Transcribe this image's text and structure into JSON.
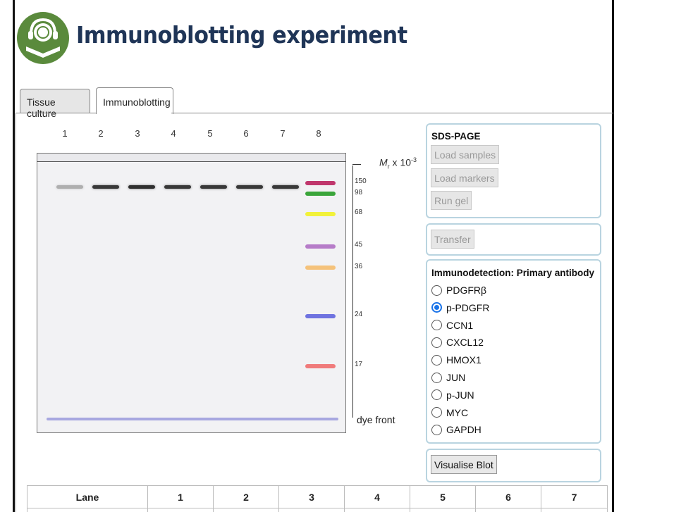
{
  "page": {
    "title": "Immunoblotting experiment"
  },
  "tabs": [
    {
      "label": "Tissue culture"
    },
    {
      "label": "Immunoblotting"
    }
  ],
  "gel": {
    "lane_numbers": [
      "1",
      "2",
      "3",
      "4",
      "5",
      "6",
      "7",
      "8"
    ],
    "mr_label_prefix": "M",
    "mr_label_sub": "r",
    "mr_label_mid": " x 10",
    "mr_label_sup": "-3",
    "size_markers": [
      "150",
      "98",
      "68",
      "45",
      "36",
      "24",
      "17"
    ],
    "dye_front_label": "dye front",
    "marker_colors": {
      "150": "#c0376d",
      "98": "#3aa53a",
      "68": "#f2f23a",
      "45": "#b67cc8",
      "36": "#f5c27a",
      "24": "#6f73e0",
      "17": "#f07b7b"
    },
    "sample_band_intensity": [
      0.15,
      0.85,
      0.9,
      0.85,
      0.85,
      0.85,
      0.85
    ]
  },
  "sds_page": {
    "title": "SDS-PAGE",
    "load_samples": "Load samples",
    "load_markers": "Load markers",
    "run_gel": "Run gel"
  },
  "transfer": {
    "label": "Transfer"
  },
  "immunodetection": {
    "title": "Immunodetection: Primary antibody",
    "selected": "p-PDGFR",
    "options": [
      "PDGFRβ",
      "p-PDGFR",
      "CCN1",
      "CXCL12",
      "HMOX1",
      "JUN",
      "p-JUN",
      "MYC",
      "GAPDH"
    ]
  },
  "visualise": {
    "label": "Visualise Blot"
  },
  "table": {
    "headers": [
      "Lane",
      "1",
      "2",
      "3",
      "4",
      "5",
      "6",
      "7"
    ]
  }
}
